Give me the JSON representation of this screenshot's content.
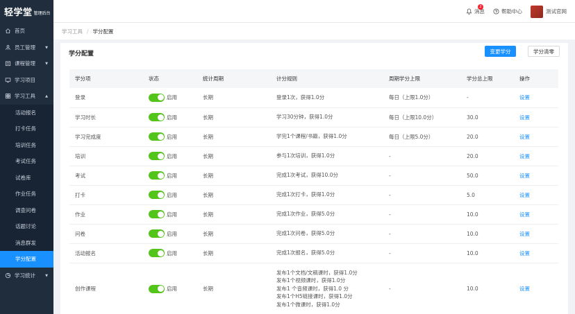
{
  "brand": {
    "name": "轻学堂",
    "sub": "管理后台"
  },
  "sidebar": {
    "items": [
      {
        "label": "首页",
        "icon": "home-icon",
        "arrow": ""
      },
      {
        "label": "员工管理",
        "icon": "users-icon",
        "arrow": "▼"
      },
      {
        "label": "课程管理",
        "icon": "folder-icon",
        "arrow": "▼"
      },
      {
        "label": "学习项目",
        "icon": "monitor-icon",
        "arrow": ""
      },
      {
        "label": "学习工具",
        "icon": "grid-icon",
        "arrow": "▲"
      }
    ],
    "sub_items": [
      "活动报名",
      "打卡任务",
      "培训任务",
      "考试任务",
      "试卷库",
      "作业任务",
      "调查问卷",
      "话题讨论",
      "消息群发",
      "学分配置"
    ],
    "bottom_items": [
      {
        "label": "学习统计",
        "icon": "pie-icon",
        "arrow": "▼"
      }
    ]
  },
  "topbar": {
    "messages_label": "消息",
    "messages_badge": "2",
    "help_label": "帮助中心",
    "user_name": "测试官网"
  },
  "breadcrumb": {
    "parent": "学习工具",
    "sep": "/",
    "current": "学分配置"
  },
  "page": {
    "title": "学分配置",
    "change_button": "变更学分",
    "clear_button": "学分清零"
  },
  "table": {
    "headers": [
      "学分项",
      "状态",
      "统计周期",
      "计分规则",
      "周期学分上限",
      "学分总上限",
      "操作"
    ],
    "enabled_label": "启用",
    "action_label": "设置",
    "rows": [
      {
        "item": "登录",
        "period": "长期",
        "rule": [
          "登录1次，获得1.0分"
        ],
        "cycle_limit": "每日（上限1.0分）",
        "total_limit": "-"
      },
      {
        "item": "学习时长",
        "period": "长期",
        "rule": [
          "学习30分钟，获得1.0分"
        ],
        "cycle_limit": "每日（上限10.0分）",
        "total_limit": "30.0"
      },
      {
        "item": "学习完成度",
        "period": "长期",
        "rule": [
          "学完1个课程/书籍，获得1.0分"
        ],
        "cycle_limit": "每日（上限5.0分）",
        "total_limit": "20.0"
      },
      {
        "item": "培训",
        "period": "长期",
        "rule": [
          "参与1次培训，获得1.0分"
        ],
        "cycle_limit": "-",
        "total_limit": "20.0"
      },
      {
        "item": "考试",
        "period": "长期",
        "rule": [
          "完成1次考试，获得10.0分"
        ],
        "cycle_limit": "-",
        "total_limit": "50.0"
      },
      {
        "item": "打卡",
        "period": "长期",
        "rule": [
          "完成1次打卡，获得1.0分"
        ],
        "cycle_limit": "-",
        "total_limit": "5.0"
      },
      {
        "item": "作业",
        "period": "长期",
        "rule": [
          "完成1次作业，获得5.0分"
        ],
        "cycle_limit": "-",
        "total_limit": "10.0"
      },
      {
        "item": "问卷",
        "period": "长期",
        "rule": [
          "完成1次问卷，获得5.0分"
        ],
        "cycle_limit": "-",
        "total_limit": "10.0"
      },
      {
        "item": "活动报名",
        "period": "长期",
        "rule": [
          "完成1次报名，获得5.0分"
        ],
        "cycle_limit": "-",
        "total_limit": "10.0"
      },
      {
        "item": "创作课程",
        "period": "长期",
        "rule": [
          "发布1个文档/文稿课时，获得1.0分",
          "发布1个视频课时，获得1.0分",
          "发布1 个音频课时，获得1.0 分",
          "发布1个H5链接课时，获得1.0分",
          "发布1个微课时，获得1.0分"
        ],
        "cycle_limit": "-",
        "total_limit": "10.0"
      }
    ]
  }
}
